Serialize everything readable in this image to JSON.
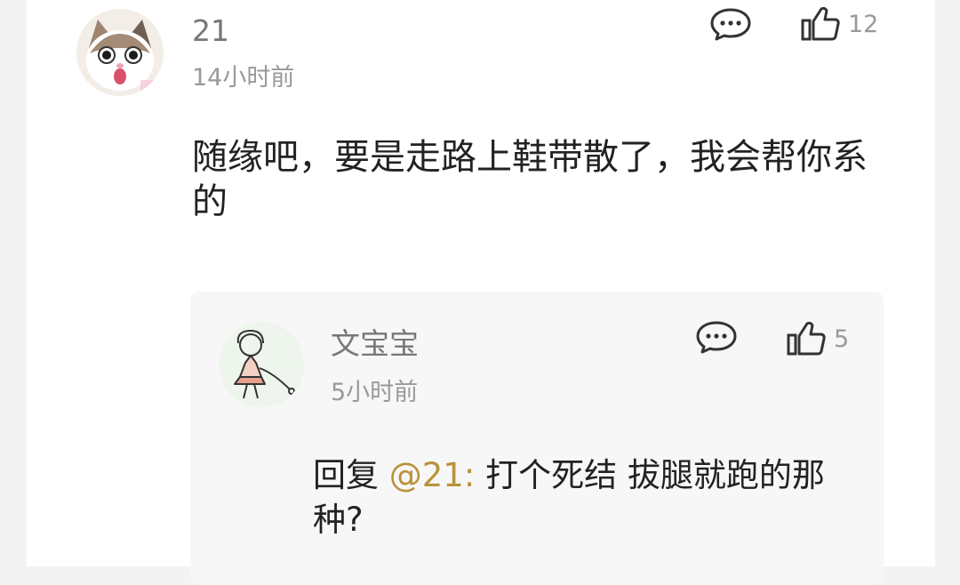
{
  "comment": {
    "username": "21",
    "time": "14小时前",
    "text": "随缘吧，要是走路上鞋带散了，我会帮你系的",
    "like_count": "12",
    "icons": {
      "comment": "comment-bubble-icon",
      "like": "thumbs-up-icon"
    },
    "avatar": "cat-avatar"
  },
  "reply": {
    "username": "文宝宝",
    "time": "5小时前",
    "prefix": "回复",
    "mention": "@21:",
    "text": "打个死结 拔腿就跑的那种?",
    "like_count": "5",
    "icons": {
      "comment": "comment-bubble-icon",
      "like": "thumbs-up-icon"
    },
    "avatar": "girl-sketch-avatar"
  },
  "colors": {
    "mention": "#b9923b",
    "muted": "#999999",
    "reply_bg": "#f7f7f7"
  }
}
